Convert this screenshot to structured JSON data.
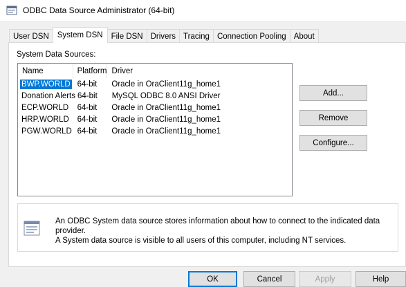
{
  "window": {
    "title": "ODBC Data Source Administrator (64-bit)"
  },
  "tabs": [
    {
      "label": "User DSN",
      "active": false
    },
    {
      "label": "System DSN",
      "active": true
    },
    {
      "label": "File DSN",
      "active": false
    },
    {
      "label": "Drivers",
      "active": false
    },
    {
      "label": "Tracing",
      "active": false
    },
    {
      "label": "Connection Pooling",
      "active": false
    },
    {
      "label": "About",
      "active": false
    }
  ],
  "panel": {
    "section_label": "System Data Sources:",
    "columns": {
      "name": "Name",
      "platform": "Platform",
      "driver": "Driver"
    },
    "rows": [
      {
        "name": "BWP.WORLD",
        "platform": "64-bit",
        "driver": "Oracle in OraClient11g_home1",
        "selected": true
      },
      {
        "name": "Donation Alerts",
        "platform": "64-bit",
        "driver": "MySQL ODBC 8.0 ANSI Driver",
        "selected": false
      },
      {
        "name": "ECP.WORLD",
        "platform": "64-bit",
        "driver": "Oracle in OraClient11g_home1",
        "selected": false
      },
      {
        "name": "HRP.WORLD",
        "platform": "64-bit",
        "driver": "Oracle in OraClient11g_home1",
        "selected": false
      },
      {
        "name": "PGW.WORLD",
        "platform": "64-bit",
        "driver": "Oracle in OraClient11g_home1",
        "selected": false
      }
    ],
    "buttons": {
      "add": "Add...",
      "remove": "Remove",
      "configure": "Configure..."
    },
    "info": {
      "icon": "data-source-icon",
      "line1": "An ODBC System data source stores information about how to connect to the indicated data provider.",
      "line2": "A System data source is visible to all users of this computer, including NT services."
    }
  },
  "footer": {
    "ok": "OK",
    "cancel": "Cancel",
    "apply": "Apply",
    "help": "Help"
  },
  "colors": {
    "selection": "#0078d7",
    "default_button_border": "#0078d7",
    "dialog_bg": "#f0f0f0"
  }
}
